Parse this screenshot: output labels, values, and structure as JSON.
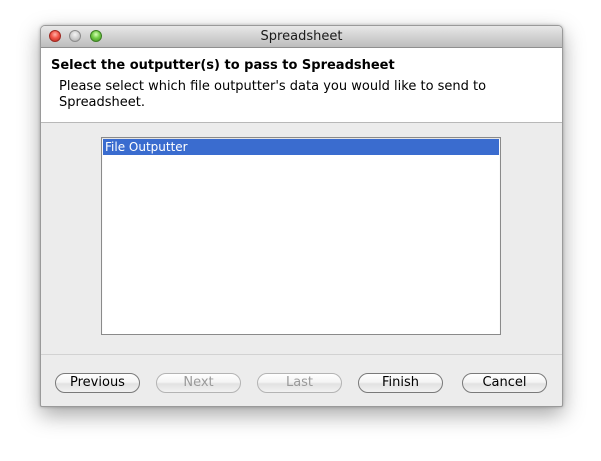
{
  "window": {
    "title": "Spreadsheet"
  },
  "header": {
    "title": "Select the outputter(s) to pass to Spreadsheet",
    "description": "Please select which file outputter's data you would like to send to Spreadsheet."
  },
  "outputter_list": {
    "items": [
      {
        "label": "File Outputter",
        "selected": true
      }
    ]
  },
  "buttons": {
    "previous": "Previous",
    "next": "Next",
    "last": "Last",
    "finish": "Finish",
    "cancel": "Cancel"
  },
  "colors": {
    "selection": "#3a6ccf",
    "close": "#f2564a",
    "zoom": "#74cd48"
  }
}
